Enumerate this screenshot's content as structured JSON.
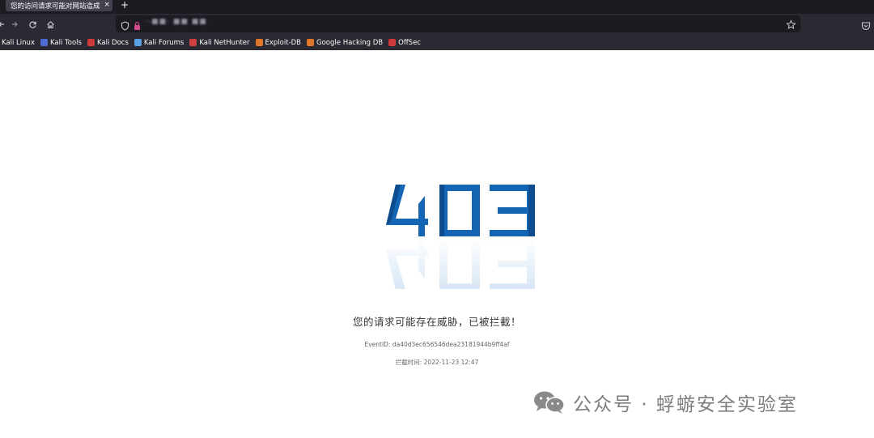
{
  "browser": {
    "tab_title": "您的访问请求可能对网站造成",
    "tab_close": "×",
    "new_tab": "+",
    "url_text": "·-■■· ■■ ■■",
    "bookmarks": [
      {
        "label": "Kali Linux",
        "icon": "kali-icon",
        "color": "#3b82c4"
      },
      {
        "label": "Kali Tools",
        "icon": "kali-tools-icon",
        "color": "#4f6bd6"
      },
      {
        "label": "Kali Docs",
        "icon": "kali-docs-icon",
        "color": "#d03a3a"
      },
      {
        "label": "Kali Forums",
        "icon": "kali-forums-icon",
        "color": "#5aa0e6"
      },
      {
        "label": "Kali NetHunter",
        "icon": "nethunter-icon",
        "color": "#d04040"
      },
      {
        "label": "Exploit-DB",
        "icon": "exploit-db-icon",
        "color": "#e0762a"
      },
      {
        "label": "Google Hacking DB",
        "icon": "ghdb-icon",
        "color": "#e0762a"
      },
      {
        "label": "OffSec",
        "icon": "offsec-icon",
        "color": "#d03a3a"
      }
    ]
  },
  "page": {
    "code": "403",
    "code_color": "#1565b5",
    "message": "您的请求可能存在威胁，已被拦截！",
    "event_id": "EventID: da40d3ec656546dea23181944b9ff4af",
    "block_time": "拦截时间: 2022-11-23 12:47"
  },
  "watermark": {
    "text": "公众号 · 蜉蝣安全实验室",
    "icon": "wechat-icon"
  }
}
